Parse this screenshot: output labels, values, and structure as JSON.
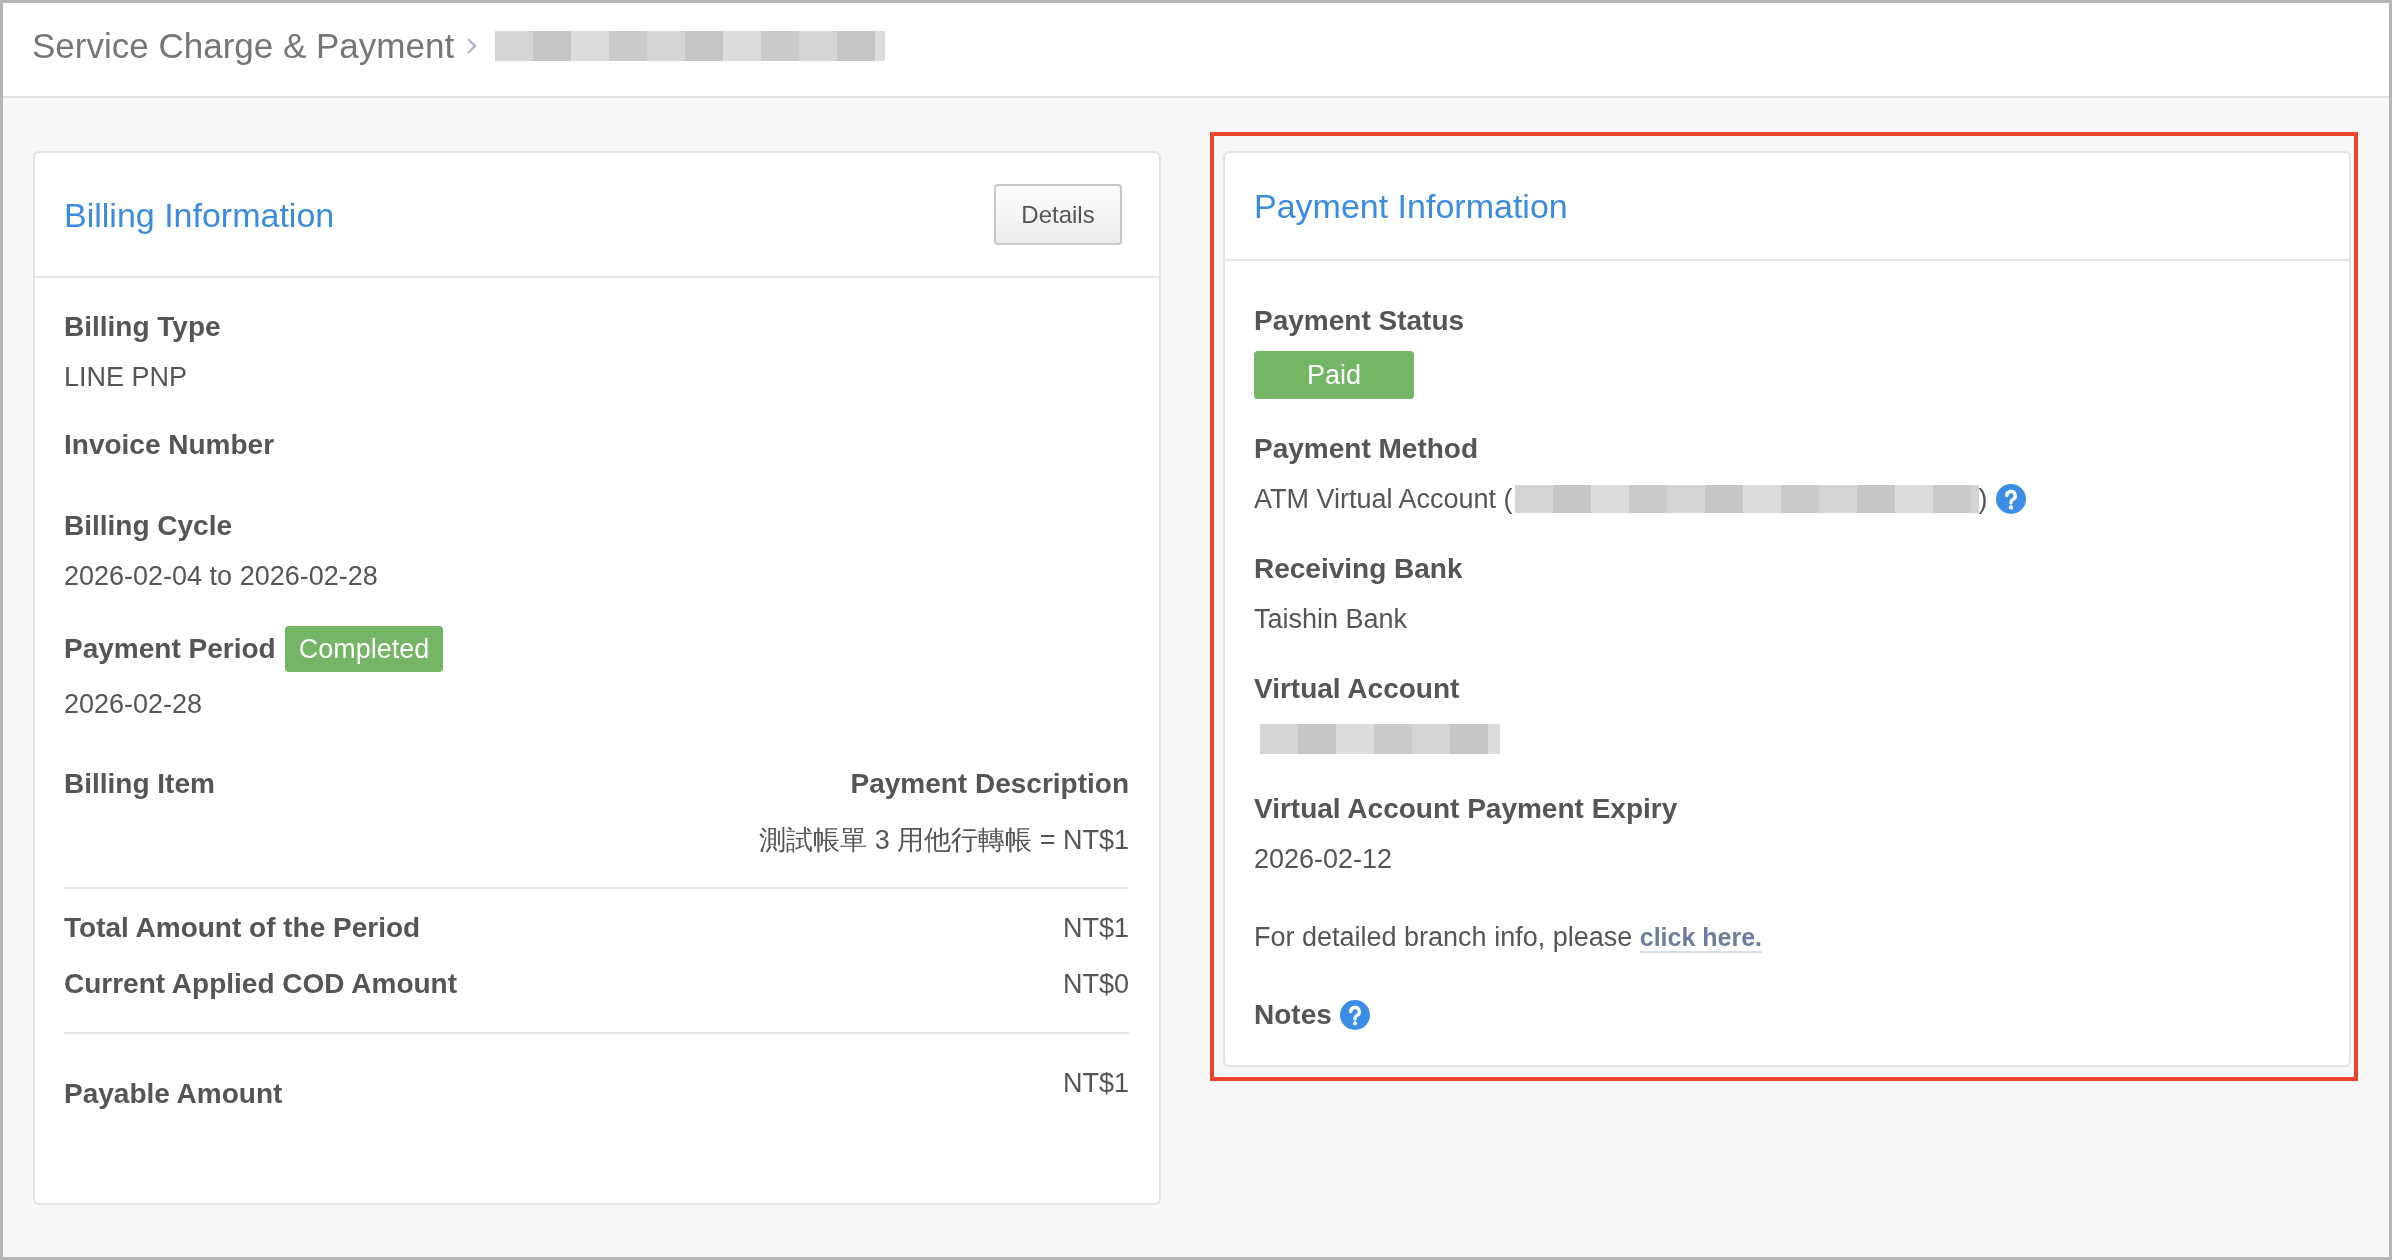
{
  "breadcrumb": {
    "title": "Service Charge & Payment",
    "redacted_current": true
  },
  "billing": {
    "title": "Billing Information",
    "button": "Details",
    "fields": [
      {
        "label": "Billing Type",
        "value": "LINE PNP"
      },
      {
        "label": "Invoice Number"
      },
      {
        "label": "Billing Cycle",
        "value": "2026-02-04 to 2026-02-28"
      },
      {
        "label": "Payment Period",
        "badge": "Completed",
        "value": "2026-02-28"
      }
    ],
    "items": {
      "columns": [
        "Billing Item",
        "Payment Description"
      ],
      "rows": [
        {
          "payment_description": "測試帳單 3 用他行轉帳 = NT$1"
        }
      ]
    },
    "totals": [
      {
        "label": "Total Amount of the Period",
        "value": "NT$1"
      },
      {
        "label": "Current Applied COD Amount",
        "value": "NT$0"
      }
    ],
    "payable": {
      "label": "Payable Amount",
      "value": "NT$1"
    }
  },
  "payment": {
    "title": "Payment Information",
    "highlighted": true,
    "fields": [
      {
        "kind": "badge",
        "label": "Payment Status",
        "value": "Paid"
      },
      {
        "kind": "text",
        "label": "Payment Method",
        "value": "ATM Virtual Account (",
        "redacted": true,
        "suffix": ")",
        "help": true
      },
      {
        "kind": "text",
        "label": "Receiving Bank",
        "value": "Taishin Bank"
      },
      {
        "kind": "text",
        "label": "Virtual Account",
        "redacted": true
      },
      {
        "kind": "text",
        "label": "Virtual Account Payment Expiry",
        "value": "2026-02-12"
      },
      {
        "kind": "link",
        "text": "For detailed branch info, please",
        "link": "click here."
      },
      {
        "kind": "text",
        "label": "Notes",
        "help": true
      }
    ]
  }
}
